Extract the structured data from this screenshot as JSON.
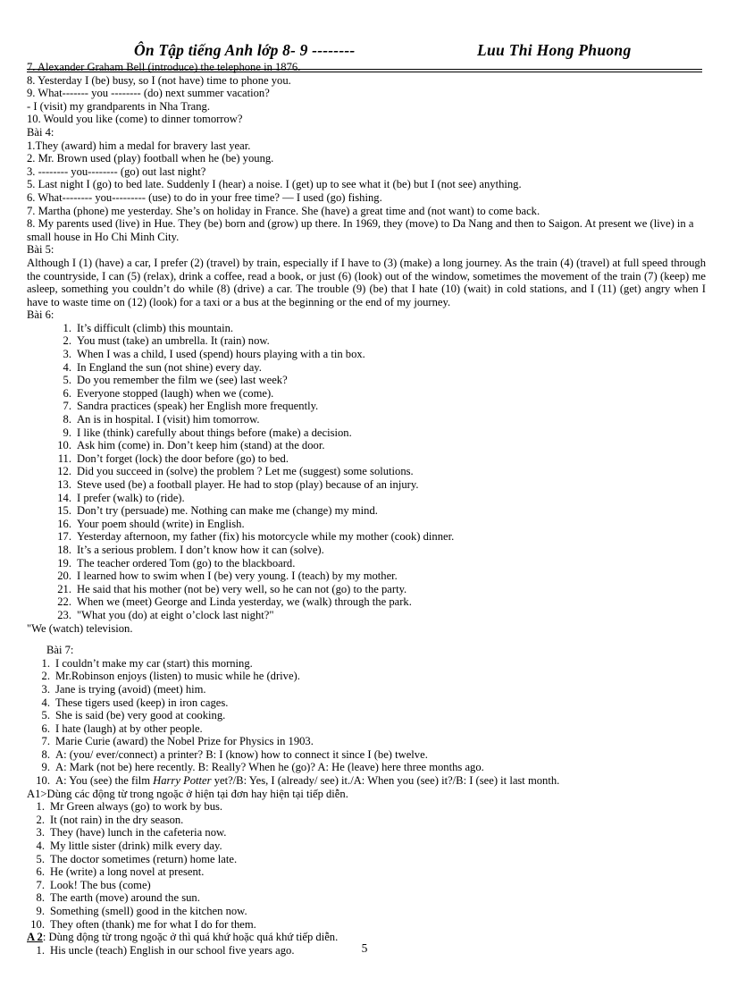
{
  "header": {
    "title": "Ôn Tập tiếng Anh lớp 8- 9 --------",
    "author": "Luu Thi Hong Phuong"
  },
  "page_number": "5",
  "bai3_tail": {
    "items": [
      "7. Alexander Graham Bell (introduce) the telephone in 1876.",
      "8. Yesterday I (be) busy, so I (not have) time to phone you.",
      "9. What------- you -------- (do) next summer vacation?",
      "- I (visit) my grandparents in Nha Trang.",
      "10. Would you like (come) to dinner tomorrow?"
    ]
  },
  "bai4": {
    "label": "Bài 4:",
    "items": [
      "1.They (award) him a medal for bravery last year.",
      "2. Mr. Brown used (play) football when he (be) young.",
      "3. -------- you-------- (go) out last night?",
      "5. Last night I (go) to bed late. Suddenly I (hear) a noise. I (get) up to see what it (be) but I (not see) anything.",
      "6. What-------- you--------- (use) to do in your free time? — I used (go) fishing.",
      "7. Martha (phone) me yesterday. She’s on holiday in France. She (have) a great time and (not want) to come back.",
      "8. My parents used (live) in Hue. They (be) born and (grow) up there. In 1969, they (move) to Da Nang and then to Saigon. At present we (live) in a small house in Ho Chi Minh City."
    ]
  },
  "bai5": {
    "label": "Bài 5:",
    "paragraph": " Although I (1) (have) a car, I prefer (2) (travel) by train, especially if I have to (3) (make) a long journey. As the train (4) (travel) at full speed through the countryside, I can (5) (relax), drink a coffee, read a book, or just (6) (look) out of the window, sometimes the movement of the train (7) (keep) me asleep, something you couldn’t do while (8) (drive) a car. The trouble (9) (be) that I hate (10) (wait) in cold stations, and I (11) (get) angry when I have to waste time on (12) (look) for a taxi or a bus at the beginning or the end of my journey."
  },
  "bai6": {
    "label": "Bài 6:",
    "items": [
      {
        "num": "1.",
        "text": "It’s difficult (climb) this mountain."
      },
      {
        "num": "2.",
        "text": "You must (take) an umbrella. It (rain) now."
      },
      {
        "num": "3.",
        "text": "When I was a child, I used (spend) hours playing with a tin box."
      },
      {
        "num": "4.",
        "text": "In England the sun (not shine) every day."
      },
      {
        "num": "5.",
        "text": "Do you remember the film we (see) last week?"
      },
      {
        "num": "6.",
        "text": "Everyone stopped (laugh) when we (come)."
      },
      {
        "num": "7.",
        "text": "Sandra practices (speak) her English more frequently."
      },
      {
        "num": "8.",
        "text": "An is in hospital. I (visit) him tomorrow."
      },
      {
        "num": "9.",
        "text": "I like (think) carefully about things before (make) a decision."
      },
      {
        "num": "10.",
        "text": "Ask him (come) in. Don’t keep him (stand) at the door."
      },
      {
        "num": "11.",
        "text": "Don’t  forget (lock) the door before (go) to bed."
      },
      {
        "num": "12.",
        "text": "Did you succeed in (solve) the problem ? Let me (suggest) some solutions."
      },
      {
        "num": "13.",
        "text": "Steve used (be) a football player. He had to stop (play) because of an injury."
      },
      {
        "num": "14.",
        "text": "I prefer (walk) to (ride)."
      },
      {
        "num": "15.",
        "text": "Don’t try (persuade) me. Nothing can make me (change) my mind."
      },
      {
        "num": "16.",
        "text": "Your poem should (write) in English."
      },
      {
        "num": "17.",
        "text": "Yesterday afternoon, my father (fix) his motorcycle while my mother (cook) dinner."
      },
      {
        "num": "18.",
        "text": "It’s a serious problem. I don’t know how it can (solve)."
      },
      {
        "num": "19.",
        "text": "The teacher ordered Tom (go) to the blackboard."
      },
      {
        "num": "20.",
        "text": "I learned how to swim when I (be) very young. I (teach) by my mother."
      },
      {
        "num": "21.",
        "text": "He said that his mother (not be) very well, so he can not (go) to the party."
      },
      {
        "num": "22.",
        "text": "When we (meet) George and Linda yesterday, we (walk) through the park."
      },
      {
        "num": "23.",
        "text": "\"What you (do) at eight o’clock last night?\""
      }
    ],
    "continuation": "\"We (watch) television."
  },
  "bai7": {
    "label": "Bài 7:",
    "items": [
      {
        "num": "1.",
        "text": "I couldn’t make my car (start) this morning."
      },
      {
        "num": "2.",
        "text": "Mr.Robinson enjoys (listen) to music while he (drive)."
      },
      {
        "num": "3.",
        "text": "Jane is trying (avoid) (meet) him."
      },
      {
        "num": "4.",
        "text": "These tigers used (keep) in iron cages."
      },
      {
        "num": "5.",
        "text": "She is said (be) very good at cooking."
      },
      {
        "num": "6.",
        "text": "I hate (laugh) at by other people."
      },
      {
        "num": "7.",
        "text": "Marie Curie (award) the Nobel Prize for Physics in 1903."
      },
      {
        "num": "8.",
        "text": "A: (you/ ever/connect) a printer?   B: I (know) how to connect it since I (be) twelve."
      },
      {
        "num": "9.",
        "text": "A: Mark (not be) here recently.      B: Really? When he (go)?    A: He (leave) here three months ago."
      }
    ],
    "item10": {
      "num": "10.",
      "pre": "A: You (see) the film ",
      "italic": "Harry Potter",
      "post": " yet?/B: Yes, I (already/ see) it./A: When you (see) it?/B: I (see) it last month."
    }
  },
  "a1": {
    "label": "A1>Dùng các động từ trong ngoặc ở hiện tại đơn hay hiện tại tiếp diễn.",
    "items": [
      {
        "num": "1.",
        "text": "Mr Green always (go) to work by bus."
      },
      {
        "num": "2.",
        "text": "It (not rain) in the dry season."
      },
      {
        "num": "3.",
        "text": "They (have) lunch in the cafeteria now."
      },
      {
        "num": "4.",
        "text": "My little sister (drink) milk every day."
      },
      {
        "num": "5.",
        "text": "The doctor sometimes (return) home late."
      },
      {
        "num": "6.",
        "text": "He (write) a long novel at present."
      },
      {
        "num": "7.",
        "text": "Look! The bus (come)"
      },
      {
        "num": "8.",
        "text": "The earth (move) around the sun."
      },
      {
        "num": "9.",
        "text": "Something (smell) good in the kitchen now."
      },
      {
        "num": "10.",
        "text": "They often (thank) me for what I do for them."
      }
    ]
  },
  "a2": {
    "label_bold": "A 2",
    "label_rest": ": Dùng động từ trong ngoặc ở thì quá khứ hoặc quá khứ tiếp diễn.",
    "items": [
      {
        "num": "1.",
        "text": "His uncle (teach) English in our school five years ago."
      }
    ]
  }
}
